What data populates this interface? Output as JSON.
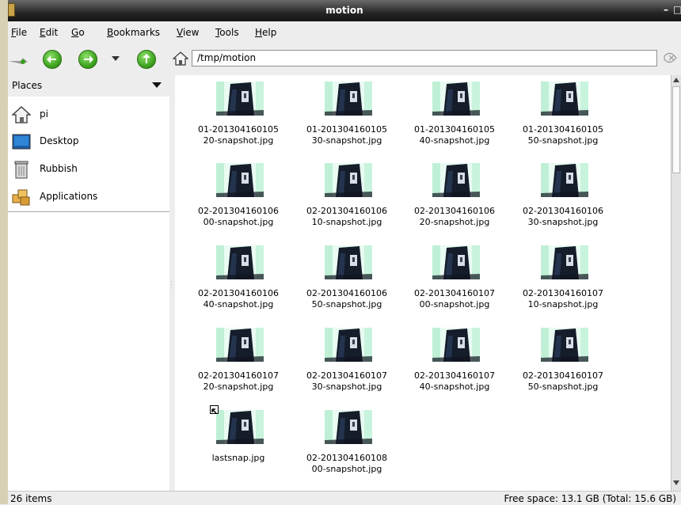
{
  "window": {
    "title": "motion"
  },
  "menu": {
    "file": {
      "mnemonic": "F",
      "rest": "ile"
    },
    "edit": {
      "mnemonic": "E",
      "rest": "dit"
    },
    "go": {
      "mnemonic": "G",
      "rest": "o"
    },
    "bookmarks": {
      "mnemonic": "B",
      "rest": "ookmarks"
    },
    "view": {
      "mnemonic": "V",
      "rest": "iew"
    },
    "tools": {
      "mnemonic": "T",
      "rest": "ools"
    },
    "help": {
      "mnemonic": "H",
      "rest": "elp"
    }
  },
  "location": {
    "path": "/tmp/motion"
  },
  "places": {
    "header": "Places",
    "items": [
      "pi",
      "Desktop",
      "Rubbish",
      "Applications"
    ]
  },
  "files": [
    {
      "line1": "01-201304160105",
      "line2": "20-snapshot.jpg"
    },
    {
      "line1": "01-201304160105",
      "line2": "30-snapshot.jpg"
    },
    {
      "line1": "01-201304160105",
      "line2": "40-snapshot.jpg"
    },
    {
      "line1": "01-201304160105",
      "line2": "50-snapshot.jpg"
    },
    {
      "line1": "02-201304160106",
      "line2": "00-snapshot.jpg"
    },
    {
      "line1": "02-201304160106",
      "line2": "10-snapshot.jpg"
    },
    {
      "line1": "02-201304160106",
      "line2": "20-snapshot.jpg"
    },
    {
      "line1": "02-201304160106",
      "line2": "30-snapshot.jpg"
    },
    {
      "line1": "02-201304160106",
      "line2": "40-snapshot.jpg"
    },
    {
      "line1": "02-201304160106",
      "line2": "50-snapshot.jpg"
    },
    {
      "line1": "02-201304160107",
      "line2": "00-snapshot.jpg"
    },
    {
      "line1": "02-201304160107",
      "line2": "10-snapshot.jpg"
    },
    {
      "line1": "02-201304160107",
      "line2": "20-snapshot.jpg"
    },
    {
      "line1": "02-201304160107",
      "line2": "30-snapshot.jpg"
    },
    {
      "line1": "02-201304160107",
      "line2": "40-snapshot.jpg"
    },
    {
      "line1": "02-201304160107",
      "line2": "50-snapshot.jpg"
    },
    {
      "line1": "lastsnap.jpg",
      "line2": "",
      "symlink": true
    },
    {
      "line1": "02-201304160108",
      "line2": "00-snapshot.jpg"
    }
  ],
  "status": {
    "count": "26 items",
    "free_space": "Free space: 13.1 GB (Total: 15.6 GB)"
  },
  "icons": {
    "back": "back-arrow-icon",
    "forward": "forward-arrow-icon",
    "up": "up-arrow-icon",
    "home": "home-icon",
    "clear": "clear-location-icon"
  }
}
